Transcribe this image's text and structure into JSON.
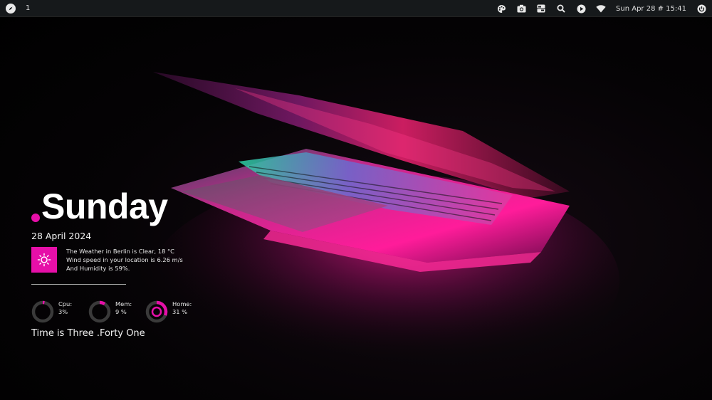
{
  "topbar": {
    "workspace": "1",
    "clock": "Sun Apr 28 # 15:41",
    "icons": [
      "palette-icon",
      "camera-icon",
      "settings-panel-icon",
      "search-icon",
      "play-icon",
      "wifi-icon",
      "power-icon"
    ]
  },
  "widget": {
    "day_dot": ".",
    "day": "Sunday",
    "date": "28 April 2024",
    "weather_lines": [
      "The Weather in Berlin is Clear, 18 °C",
      "Wind speed in your location is 6.26 m/s",
      "And Humidity is 59%."
    ],
    "gauges": [
      {
        "label": "Cpu:",
        "value": "3%",
        "fraction": 0.03
      },
      {
        "label": "Mem:",
        "value": "9 %",
        "fraction": 0.09
      },
      {
        "label": "Home:",
        "value": "31 %",
        "fraction": 0.31
      }
    ],
    "time_text": "Time is Three .Forty One"
  },
  "colors": {
    "accent": "#e60fa8",
    "topbar_bg": "#16191b",
    "gauge_track": "#3a3a3a"
  }
}
